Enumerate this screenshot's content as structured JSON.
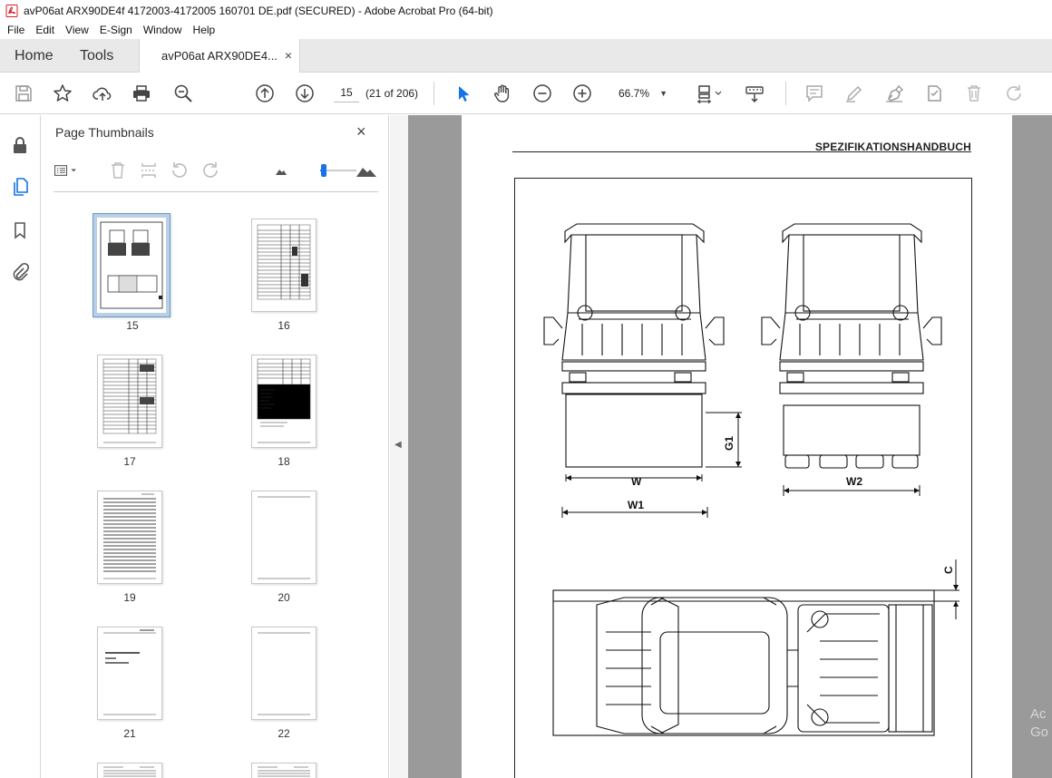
{
  "window": {
    "title": "avP06at ARX90DE4f 4172003-4172005 160701 DE.pdf (SECURED) - Adobe Acrobat Pro (64-bit)"
  },
  "menu": [
    "File",
    "Edit",
    "View",
    "E-Sign",
    "Window",
    "Help"
  ],
  "tabs": {
    "home": "Home",
    "tools": "Tools",
    "document": "avP06at ARX90DE4...",
    "close_glyph": "×"
  },
  "toolbar": {
    "page_number": "15",
    "page_count": "(21 of 206)",
    "zoom": "66.7%"
  },
  "panel": {
    "title": "Page Thumbnails",
    "close_glyph": "×",
    "zoom_slider_level": 0.1
  },
  "thumbnails": [
    {
      "label": "15",
      "selected": true
    },
    {
      "label": "16",
      "selected": false
    },
    {
      "label": "17",
      "selected": false
    },
    {
      "label": "18",
      "selected": false
    },
    {
      "label": "19",
      "selected": false
    },
    {
      "label": "20",
      "selected": false
    },
    {
      "label": "21",
      "selected": false
    },
    {
      "label": "22",
      "selected": false
    }
  ],
  "document": {
    "header": "SPEZIFIKATIONSHANDBUCH",
    "dim_labels": {
      "w": "W",
      "w1": "W1",
      "w2": "W2",
      "g1": "G1",
      "c": "C"
    }
  },
  "watermark": "Ac\nGo",
  "colors": {
    "accent": "#1473e6",
    "pdf_red": "#d71f26",
    "doc_background": "#9a9a9a"
  }
}
